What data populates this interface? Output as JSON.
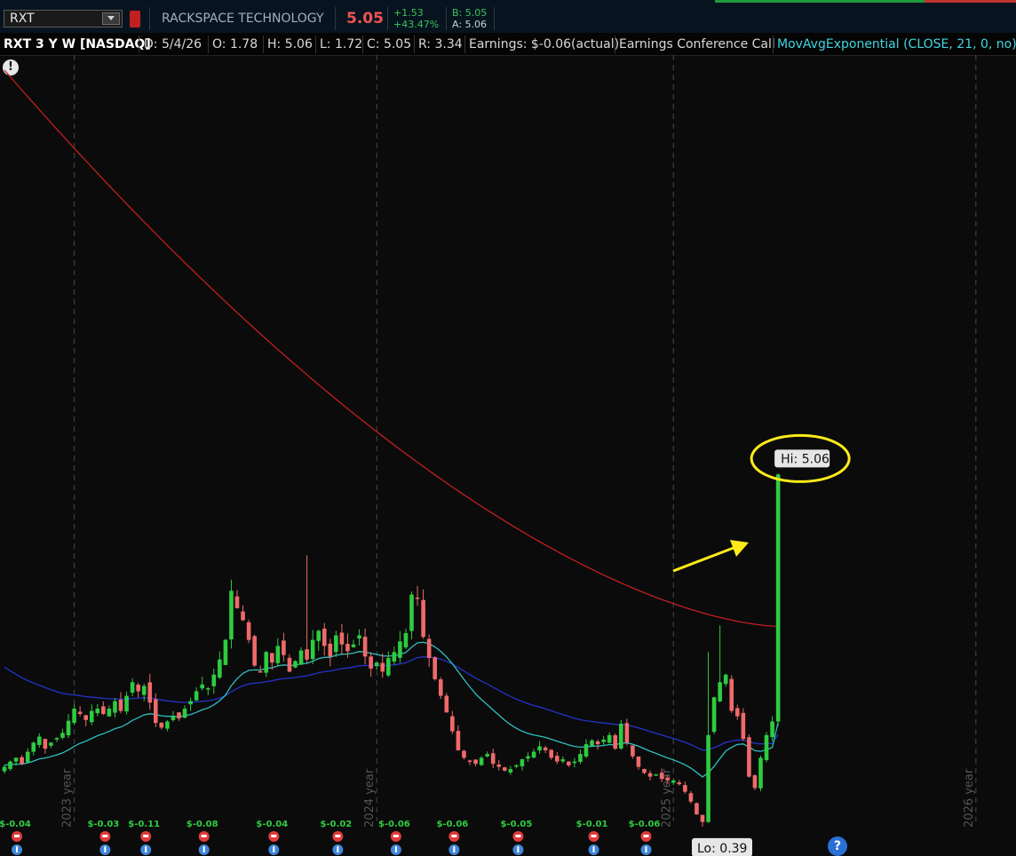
{
  "header": {
    "symbol": "RXT",
    "company": "RACKSPACE TECHNOLOGY",
    "last": "5.05",
    "net_change": "+1.53",
    "pct_change": "+43.47%",
    "bid": "B: 5.05",
    "ask": "A: 5.06"
  },
  "info": {
    "title": "RXT 3 Y W [NASDAQ]",
    "date": "D: 5/4/26",
    "open": "O: 1.78",
    "high": "H: 5.06",
    "low": "L: 1.72",
    "close": "C: 5.05",
    "range": "R: 3.34",
    "earnings": "Earnings: $-0.06(actual)",
    "event": "Earnings Conference Call",
    "study": "MovAvgExponential (CLOSE, 21, 0, no)"
  },
  "alert_icon": "!",
  "help_icon": "?",
  "colors": {
    "up": "#2ecc40",
    "down": "#f06a6a",
    "ema200": "#c11f1f",
    "ema50": "#2433c9",
    "ema21": "#2fbfbf",
    "annotation": "#ffeb1a"
  },
  "chart_data": {
    "type": "candlestick",
    "ylim": [
      0.0,
      10.6
    ],
    "year_markers": [
      {
        "label": "2023 year",
        "week": 12
      },
      {
        "label": "2024 year",
        "week": 64
      },
      {
        "label": "2025 year",
        "week": 115
      },
      {
        "label": "2026 year",
        "week": 167
      }
    ],
    "closes": [
      1.18,
      1.25,
      1.3,
      1.22,
      1.38,
      1.5,
      1.58,
      1.42,
      1.5,
      1.56,
      1.63,
      1.79,
      1.95,
      1.88,
      1.8,
      1.92,
      1.95,
      1.88,
      1.95,
      2.05,
      1.92,
      2.12,
      2.3,
      2.18,
      2.25,
      2.03,
      1.76,
      1.7,
      1.78,
      1.85,
      1.82,
      1.95,
      2.05,
      2.18,
      2.27,
      2.22,
      2.4,
      2.6,
      2.86,
      3.51,
      3.28,
      3.12,
      2.86,
      2.52,
      2.44,
      2.7,
      2.56,
      2.78,
      2.66,
      2.44,
      2.58,
      2.72,
      2.6,
      2.86,
      2.98,
      2.78,
      2.64,
      2.92,
      2.8,
      2.71,
      2.8,
      2.92,
      2.64,
      2.48,
      2.56,
      2.44,
      2.62,
      2.7,
      2.84,
      2.95,
      3.46,
      3.41,
      2.9,
      2.62,
      2.34,
      2.12,
      1.9,
      1.65,
      1.4,
      1.3,
      1.25,
      1.22,
      1.3,
      1.35,
      1.22,
      1.18,
      1.13,
      1.15,
      1.2,
      1.28,
      1.32,
      1.38,
      1.45,
      1.4,
      1.3,
      1.25,
      1.28,
      1.2,
      1.25,
      1.35,
      1.48,
      1.53,
      1.48,
      1.54,
      1.6,
      1.42,
      1.75,
      1.5,
      1.32,
      1.18,
      1.1,
      1.05,
      1.08,
      1.02,
      1.0,
      1.0,
      0.95,
      0.85,
      0.72,
      0.55,
      0.45,
      1.6,
      2.1,
      2.3,
      2.4,
      1.92,
      1.85,
      1.55,
      1.05,
      0.9,
      1.3,
      1.6,
      1.78,
      5.05
    ],
    "series": [
      {
        "name": "MovAvgExponential (CLOSE, 21, 0, no)",
        "role": "ema21"
      },
      {
        "role": "ema50",
        "start": 2.5,
        "end": 1.49
      },
      {
        "role": "ema200",
        "start": 10.4,
        "end": 3.04
      }
    ],
    "annotations": [
      {
        "label": "Hi: 5.06",
        "value": 5.06
      },
      {
        "label": "Lo: 0.39",
        "value": 0.39
      }
    ],
    "earnings": [
      {
        "label": "$-0.04",
        "week": 0
      },
      {
        "label": "$-0.03",
        "week": 17
      },
      {
        "label": "$-0.11",
        "week": 24
      },
      {
        "label": "$-0.08",
        "week": 34
      },
      {
        "label": "$-0.04",
        "week": 46
      },
      {
        "label": "$-0.02",
        "week": 57
      },
      {
        "label": "$-0.06",
        "week": 67
      },
      {
        "label": "$-0.06",
        "week": 77
      },
      {
        "label": "$-0.05",
        "week": 88
      },
      {
        "label": "$-0.01",
        "week": 101
      },
      {
        "label": "$-0.06",
        "week": 110
      }
    ]
  }
}
